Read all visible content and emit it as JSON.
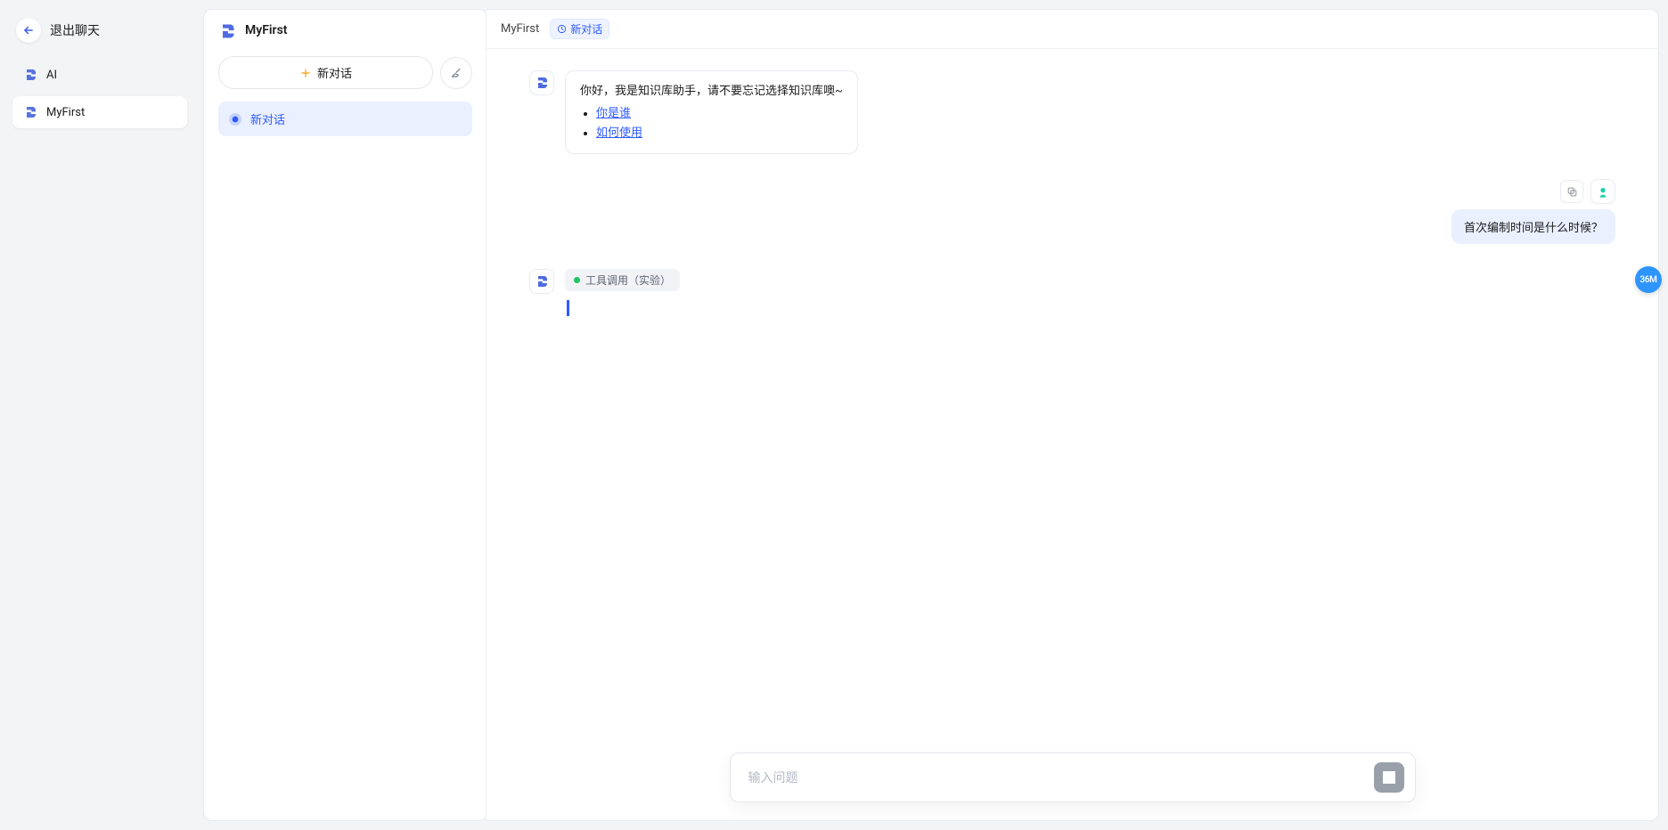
{
  "sidebar": {
    "exit_label": "退出聊天",
    "items": [
      {
        "label": "AI"
      },
      {
        "label": "MyFirst"
      }
    ]
  },
  "conv_panel": {
    "title": "MyFirst",
    "new_chat_label": "新对话",
    "conversations": [
      {
        "label": "新对话"
      }
    ]
  },
  "chat_header": {
    "title": "MyFirst",
    "badge_label": "新对话"
  },
  "messages": {
    "welcome_text": "你好，我是知识库助手，请不要忘记选择知识库噢~",
    "links": [
      {
        "text": "你是谁"
      },
      {
        "text": "如何使用"
      }
    ],
    "user_question": "首次编制时间是什么时候？",
    "tool_call_label": "工具调用（实验）"
  },
  "input": {
    "placeholder": "输入问题"
  },
  "memory_badge": "36M"
}
